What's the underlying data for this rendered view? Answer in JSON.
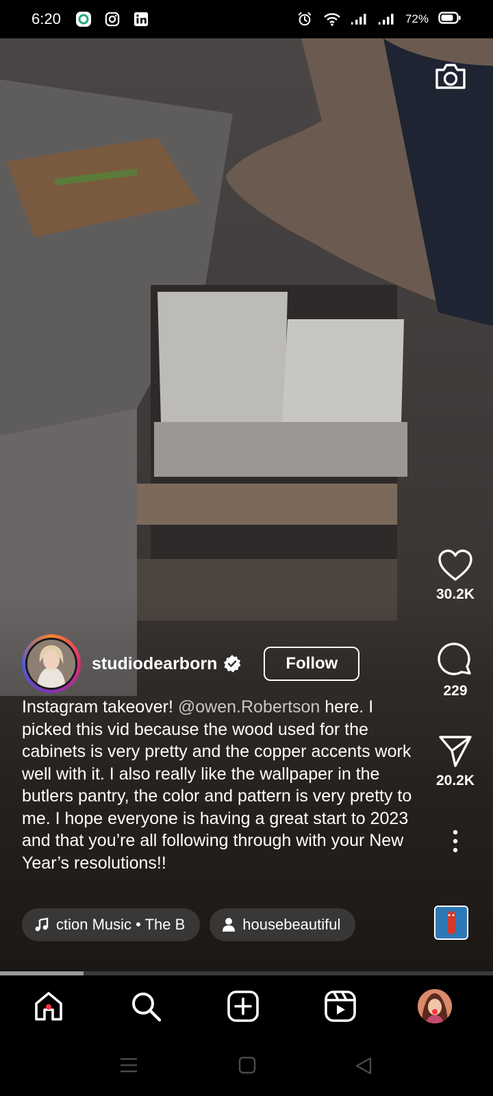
{
  "status_bar": {
    "time": "6:20",
    "battery": "72%",
    "left_icons": [
      "app-notification-icon",
      "instagram-icon",
      "linkedin-icon"
    ],
    "right_icons": [
      "alarm-icon",
      "wifi-icon",
      "signal-icon",
      "signal-icon",
      "battery-icon"
    ]
  },
  "reel": {
    "author": {
      "username": "studiodearborn",
      "verified": true,
      "follow_label": "Follow"
    },
    "caption": {
      "before": "Instagram takeover! ",
      "mention": "@owen.Robertson",
      "after": " here. I picked this vid because the wood used for the cabinets is very pretty and the copper accents work well with it. I also really like the wallpaper in the butlers pantry, the color and pattern is very pretty to me. I hope everyone is having a great start to 2023 and that you’re all following through with your New Year’s resolutions!!"
    },
    "music_chip": "ction Music • The B",
    "tag_chip": "housebeautiful",
    "likes": "30.2K",
    "comments": "229",
    "shares": "20.2K",
    "progress": 0.17
  },
  "bottom_nav": [
    "home",
    "search",
    "create",
    "reels",
    "profile"
  ],
  "colors": {
    "notification_dot": "#ff3040",
    "mention": "#c7c7c7"
  }
}
